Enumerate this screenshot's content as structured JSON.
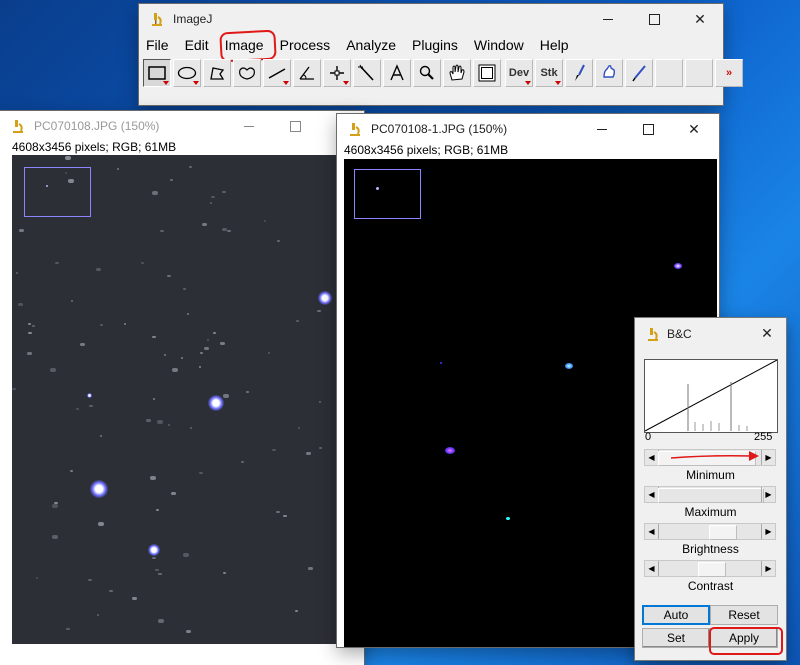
{
  "imagej": {
    "title": "ImageJ",
    "menu": [
      "File",
      "Edit",
      "Image",
      "Process",
      "Analyze",
      "Plugins",
      "Window",
      "Help"
    ],
    "tools": [
      {
        "name": "rectangle-tool",
        "icon": "rect"
      },
      {
        "name": "oval-tool",
        "icon": "oval"
      },
      {
        "name": "polygon-tool",
        "icon": "polygon"
      },
      {
        "name": "freehand-tool",
        "icon": "freehand"
      },
      {
        "name": "line-tool",
        "icon": "line"
      },
      {
        "name": "angle-tool",
        "icon": "angle"
      },
      {
        "name": "point-tool",
        "icon": "point"
      },
      {
        "name": "wand-tool",
        "icon": "wand"
      },
      {
        "name": "text-tool",
        "icon": "A"
      },
      {
        "name": "magnifier-tool",
        "icon": "magnifier"
      },
      {
        "name": "scroll-tool",
        "icon": "hand"
      },
      {
        "name": "color-picker-tool",
        "icon": "color"
      }
    ],
    "tools_right": {
      "dev": "Dev",
      "stk": "Stk",
      "more": "»"
    }
  },
  "window1": {
    "title": "PC070108.JPG (150%)",
    "info": "4608x3456 pixels; RGB; 61MB"
  },
  "window2": {
    "title": "PC070108-1.JPG (150%)",
    "info": "4608x3456 pixels; RGB; 61MB"
  },
  "bc": {
    "title": "B&C",
    "range_min": "0",
    "range_max": "255",
    "minimum_label": "Minimum",
    "maximum_label": "Maximum",
    "brightness_label": "Brightness",
    "contrast_label": "Contrast",
    "auto_label": "Auto",
    "reset_label": "Reset",
    "set_label": "Set",
    "apply_label": "Apply"
  },
  "annotation_color": "#e01818"
}
